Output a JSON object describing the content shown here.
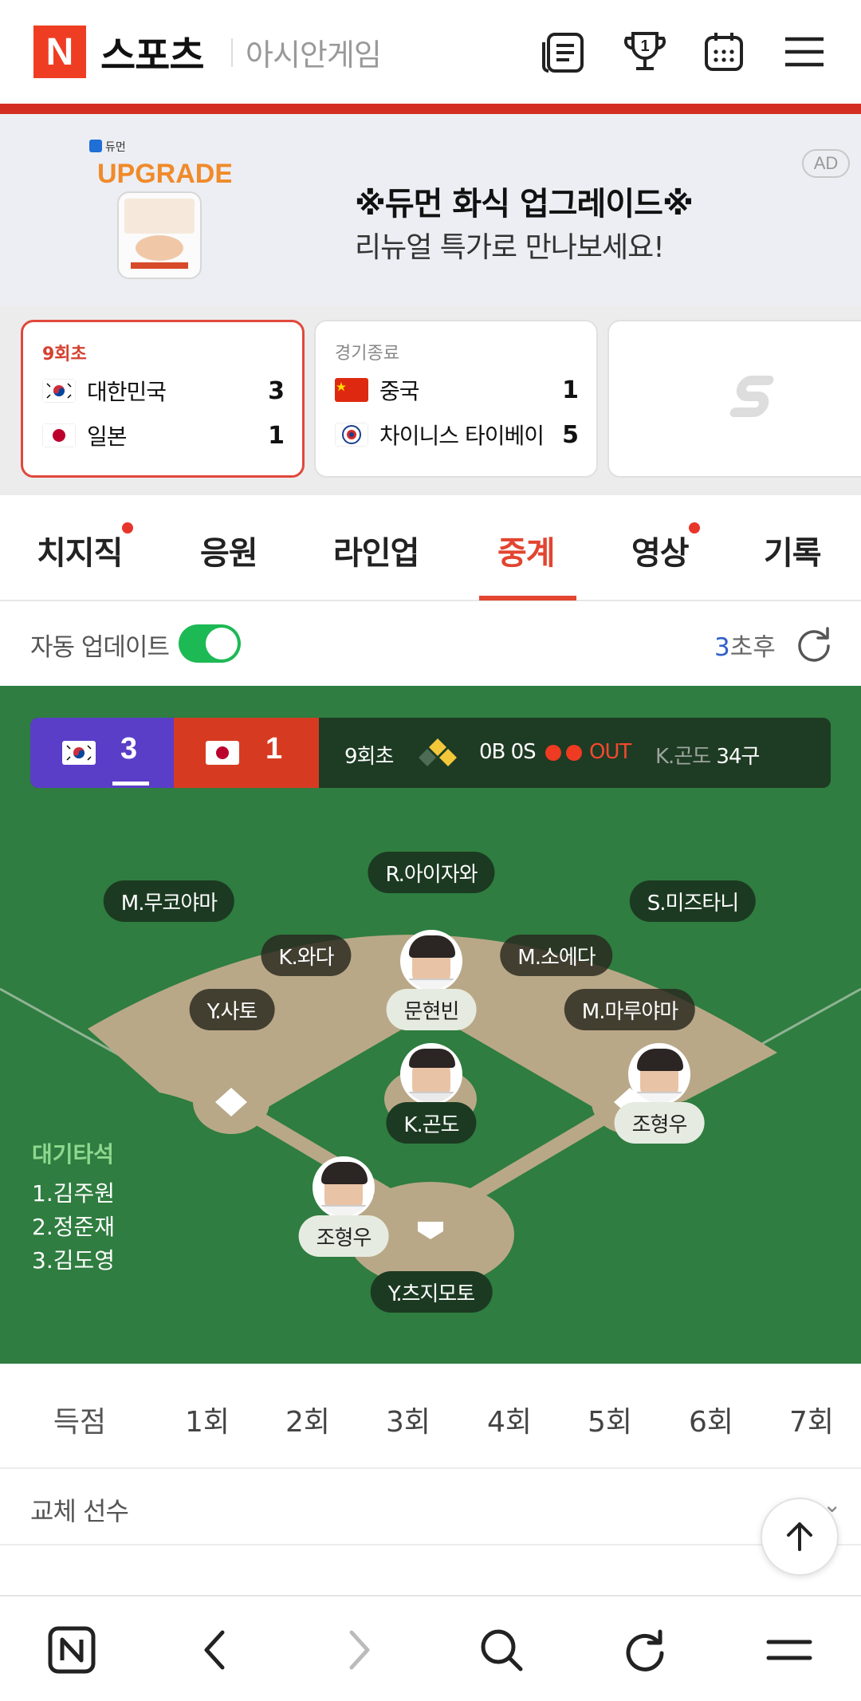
{
  "header": {
    "logo_letter": "N",
    "brand": "스포츠",
    "section": "아시안게임",
    "icons": [
      "news-list-icon",
      "trophy-icon",
      "calendar-icon",
      "menu-icon"
    ],
    "trophy_count": "1"
  },
  "ad": {
    "brand_small": "듀먼",
    "image_text": "UPGRADE",
    "title": "※듀먼 화식 업그레이드※",
    "subtitle": "리뉴얼 특가로 만나보세요!",
    "badge": "AD"
  },
  "score_cards": [
    {
      "status": "9회초",
      "teams": [
        {
          "name": "대한민국",
          "score": "3",
          "flag": "korea"
        },
        {
          "name": "일본",
          "score": "1",
          "flag": "japan"
        }
      ]
    },
    {
      "status": "경기종료",
      "teams": [
        {
          "name": "중국",
          "score": "1",
          "flag": "china"
        },
        {
          "name": "차이니스 타이베이",
          "score": "5",
          "flag": "chinese-taipei"
        }
      ]
    },
    {
      "status": "",
      "teams": []
    }
  ],
  "tabs": [
    {
      "label": "치지직",
      "dot": true
    },
    {
      "label": "응원",
      "dot": false
    },
    {
      "label": "라인업",
      "dot": false
    },
    {
      "label": "중계",
      "dot": false,
      "active": true
    },
    {
      "label": "영상",
      "dot": true
    },
    {
      "label": "기록",
      "dot": false
    }
  ],
  "auto_update": {
    "label": "자동 업데이트",
    "enabled": true,
    "inning_num": "3",
    "inning_suffix": "초후"
  },
  "scoreboard": {
    "home_score": "3",
    "away_score": "1",
    "inning": "9회초",
    "count": "0B 0S",
    "out_label": "OUT",
    "outs": 2,
    "pitcher_name": "K.곤도",
    "pitch_count": "34구"
  },
  "fielders": {
    "left_field": "M.무코야마",
    "center_field": "R.아이자와",
    "right_field": "S.미즈타니",
    "shortstop": "K.와다",
    "second_base": "M.소에다",
    "third_base": "Y.사토",
    "first_base": "M.마루야마",
    "pitcher": "K.곤도",
    "catcher": "Y.츠지모토"
  },
  "runners": {
    "second": "문현빈",
    "first": "조형우",
    "batter": "조형우"
  },
  "waiting": {
    "title": "대기타석",
    "items": [
      "1.김주원",
      "2.정준재",
      "3.김도영"
    ]
  },
  "innings": {
    "label": "득점",
    "items": [
      "1회",
      "2회",
      "3회",
      "4회",
      "5회",
      "6회",
      "7회"
    ]
  },
  "subs_label": "교체 선수",
  "colors": {
    "accent": "#e24530",
    "field_green": "#2f7d40",
    "infield": "#b9a888",
    "home_team": "#5a3ec8",
    "away_team": "#d63b22"
  }
}
